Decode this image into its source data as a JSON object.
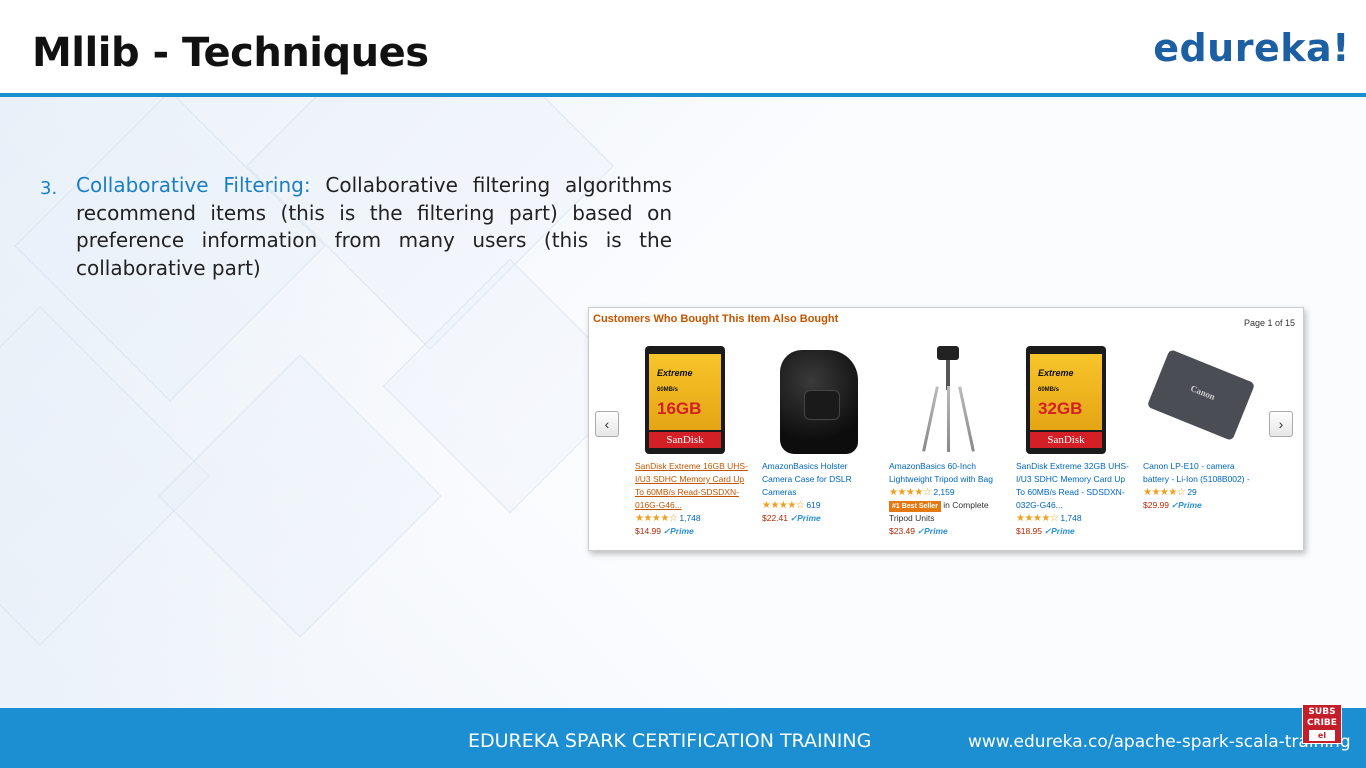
{
  "header": {
    "title": "Mllib - Techniques",
    "logo": "edureka!"
  },
  "content": {
    "number": "3.",
    "highlight": "Collaborative Filtering:",
    "text": "Collaborative filtering algorithms recommend items (this is the filtering part) based on preference information from many users (this is the collaborative part)"
  },
  "screenshot": {
    "heading": "Customers Who Bought This Item Also Bought",
    "page": "Page 1 of 15",
    "prev_icon": "‹",
    "next_icon": "›",
    "products": [
      {
        "name": "SanDisk Extreme 16GB UHS-I/U3 SDHC Memory Card Up To 60MB/s Read-SDSDXN-016G-G46...",
        "stars": "★★★★☆",
        "reviews": "1,748",
        "price": "$14.99",
        "prime": "✓Prime",
        "image": {
          "brand_top": "SanDisk",
          "line": "Extreme",
          "speed": "60MB/s",
          "capacity": "16GB",
          "brand": "SanDisk"
        }
      },
      {
        "name": "AmazonBasics Holster Camera Case for DSLR Cameras",
        "stars": "★★★★☆",
        "reviews": "619",
        "price": "$22.41",
        "prime": "✓Prime"
      },
      {
        "name": "AmazonBasics 60-Inch Lightweight Tripod with Bag",
        "stars": "★★★★☆",
        "reviews": "2,159",
        "badge": "#1 Best Seller",
        "badge_after": "in Complete Tripod Units",
        "price": "$23.49",
        "prime": "✓Prime"
      },
      {
        "name": "SanDisk Extreme 32GB UHS-I/U3 SDHC Memory Card Up To 60MB/s Read - SDSDXN-032G-G46...",
        "stars": "★★★★☆",
        "reviews": "1,748",
        "price": "$18.95",
        "prime": "✓Prime",
        "image": {
          "brand_top": "SanDisk",
          "line": "Extreme",
          "speed": "60MB/s",
          "capacity": "32GB",
          "brand": "SanDisk"
        }
      },
      {
        "name": "Canon LP-E10 - camera battery - Li-Ion (5108B002) -",
        "stars": "★★★★☆",
        "reviews": "29",
        "price": "$29.99",
        "prime": "✓Prime",
        "image": {
          "label": "Canon"
        }
      }
    ]
  },
  "footer": {
    "title": "EDUREKA SPARK CERTIFICATION TRAINING",
    "url": "www.edureka.co/apache-spark-scala-training",
    "subscribe": "SUBS CRIBE",
    "subscribe_inner": "el"
  },
  "colors": {
    "accent": "#1a8fd0",
    "logo": "#1c5fa3",
    "highlight": "#1a7fc4",
    "amazon_heading": "#c45500",
    "price": "#b12704"
  }
}
